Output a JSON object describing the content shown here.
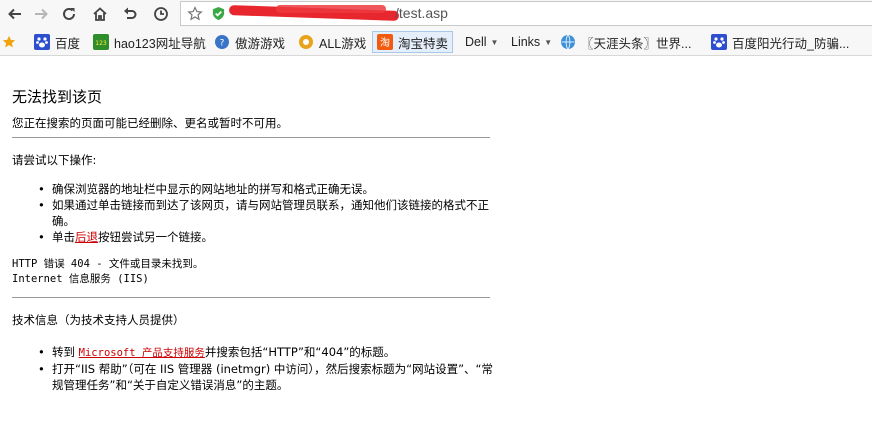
{
  "browser": {
    "url_text": "/test.asp",
    "bookmarks": [
      {
        "label": "百度",
        "icon": "baidu-paw-icon"
      },
      {
        "label": "hao123网址导航",
        "icon": "hao123-icon"
      },
      {
        "label": "傲游游戏",
        "icon": "maxthon-games-icon"
      },
      {
        "label": "ALL游戏",
        "icon": "all-games-icon"
      },
      {
        "label": "淘宝特卖",
        "icon": "taobao-icon"
      },
      {
        "label": "Dell",
        "icon": ""
      },
      {
        "label": "Links",
        "icon": ""
      },
      {
        "label": "〖天涯头条〗世界...",
        "icon": "globe-icon"
      },
      {
        "label": "百度阳光行动_防骗...",
        "icon": "baidu-paw-icon"
      }
    ],
    "accent_color": "#e8262d"
  },
  "page": {
    "title": "无法找到该页",
    "intro": "您正在搜索的页面可能已经删除、更名或暂时不可用。",
    "try_heading": "请尝试以下操作:",
    "try_items": {
      "item1": "确保浏览器的地址栏中显示的网站地址的拼写和格式正确无误。",
      "item2": "如果通过单击链接而到达了该网页，请与网站管理员联系，通知他们该链接的格式不正确。",
      "item3_pre": "单击",
      "item3_link": "后退",
      "item3_post": "按钮尝试另一个链接。"
    },
    "error_line1": "HTTP 错误 404 - 文件或目录未找到。",
    "error_line2": "Internet 信息服务 (IIS)",
    "tech_heading": "技术信息（为技术支持人员提供）",
    "tech_items": {
      "item1_pre": "转到 ",
      "item1_link": "Microsoft 产品支持服务",
      "item1_post": "并搜索包括“HTTP”和“404”的标题。",
      "item2": "打开“IIS 帮助”（可在 IIS 管理器 (inetmgr) 中访问），然后搜索标题为“网站设置”、“常规管理任务”和“关于自定义错误消息”的主题。"
    }
  }
}
